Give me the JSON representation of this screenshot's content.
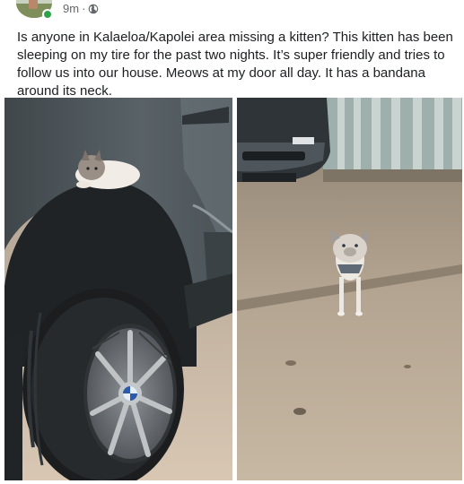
{
  "post": {
    "timestamp": "9m",
    "separator": "·",
    "text": "Is anyone in Kalaeloa/Kapolei area missing a kitten? This kitten has been sleeping on my tire for the past two nights. It’s super friendly and tries to follow us into our house. Meows at my door all day. It has a bandana around its neck.",
    "privacy_icon": "globe-icon",
    "status_color": "#31a24c"
  },
  "photos": [
    {
      "subject": "kitten-on-tire"
    },
    {
      "subject": "kitten-in-garage"
    }
  ]
}
